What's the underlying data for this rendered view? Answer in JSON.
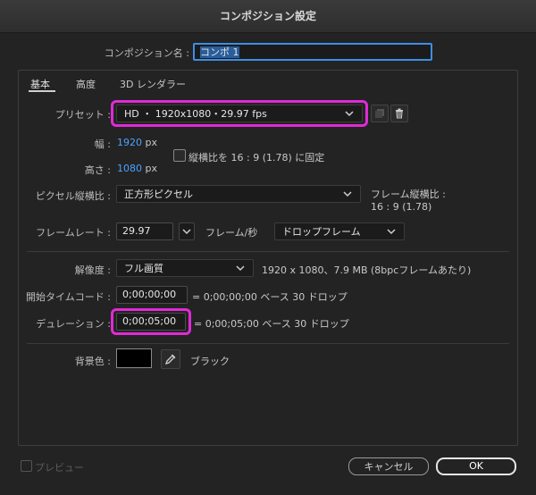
{
  "window": {
    "title": "コンポジション設定"
  },
  "comp_name": {
    "label": "コンポジション名 :",
    "value": "コンポ 1"
  },
  "tabs": [
    {
      "label": "基本",
      "active": true
    },
    {
      "label": "高度",
      "active": false
    },
    {
      "label": "3D レンダラー",
      "active": false
    }
  ],
  "preset": {
    "label": "プリセット :",
    "value": "HD ・ 1920x1080・29.97 fps"
  },
  "size": {
    "width_label": "幅 :",
    "width_value": "1920",
    "width_unit": "px",
    "height_label": "高さ :",
    "height_value": "1080",
    "height_unit": "px",
    "lock_label": "縦横比を 16 : 9 (1.78) に固定"
  },
  "pixel_aspect": {
    "label": "ピクセル縦横比 :",
    "value": "正方形ピクセル",
    "frame_aspect_label": "フレーム縦横比 :",
    "frame_aspect_value": "16 : 9 (1.78)"
  },
  "frame_rate": {
    "label": "フレームレート :",
    "value": "29.97",
    "unit": "フレーム/秒",
    "drop_value": "ドロップフレーム"
  },
  "resolution": {
    "label": "解像度 :",
    "value": "フル画質",
    "info": "1920 x 1080、7.9 MB (8bpcフレームあたり)"
  },
  "start_tc": {
    "label": "開始タイムコード :",
    "value": "0;00;00;00",
    "info": "= 0;00;00;00 ベース 30 ドロップ"
  },
  "duration": {
    "label": "デュレーション :",
    "value": "0;00;05;00",
    "info": "= 0;00;05;00 ベース 30 ドロップ"
  },
  "bg_color": {
    "label": "背景色 :",
    "name": "ブラック",
    "swatch": "#000000"
  },
  "footer": {
    "preview_label": "プレビュー",
    "cancel_label": "キャンセル",
    "ok_label": "OK"
  },
  "colors": {
    "highlight": "#e02ad6",
    "link_blue": "#4aa3ff"
  },
  "icons": [
    "chevron-down-icon",
    "duplicate-icon",
    "trash-icon",
    "eyedropper-icon"
  ]
}
